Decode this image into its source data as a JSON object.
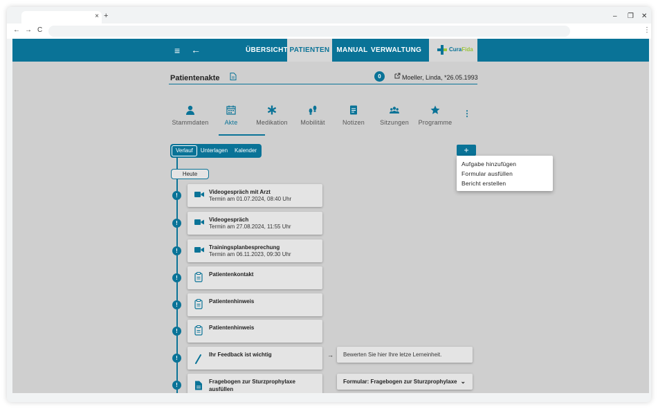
{
  "browser": {
    "tab_close": "×",
    "new_tab": "+",
    "minimize": "–",
    "restore": "❐",
    "close": "✕",
    "back": "←",
    "forward": "→",
    "reload": "C",
    "menu": "⋮"
  },
  "app": {
    "burger": "≡",
    "back": "←",
    "nav": [
      "ÜBERSICHT",
      "PATIENTEN",
      "MANUAL",
      "VERWALTUNG"
    ],
    "active_nav": "PATIENTEN",
    "logo_a": "Cura",
    "logo_b": "Fida",
    "brand_color": "#0a7397",
    "logo_accent": "#9bc43a"
  },
  "patient": {
    "title": "Patientenakte",
    "badge": "0",
    "name": "Moeller, Linda, *26.05.1993"
  },
  "tabs": [
    "Stammdaten",
    "Akte",
    "Medikation",
    "Mobilität",
    "Notizen",
    "Sitzungen",
    "Programme"
  ],
  "active_tab": "Akte",
  "more": "⋮",
  "segments": [
    "Verlauf",
    "Unterlagen",
    "Kalender"
  ],
  "active_segment": "Verlauf",
  "add_button": "+",
  "add_menu": [
    "Aufgabe hinzufügen",
    "Formular ausfüllen",
    "Bericht erstellen"
  ],
  "today_label": "Heute",
  "marker": "!",
  "arrow": "→",
  "chevron": "⌄",
  "timeline": [
    {
      "icon": "video-icon",
      "title": "Videogespräch mit Arzt",
      "subtitle": "Termin am 01.07.2024, 08:40 Uhr"
    },
    {
      "icon": "video-icon",
      "title": "Videogespräch",
      "subtitle": "Termin am 27.08.2024, 11:55 Uhr"
    },
    {
      "icon": "video-icon",
      "title": "Trainingsplanbesprechung",
      "subtitle": "Termin am 06.11.2023, 09:30 Uhr"
    },
    {
      "icon": "clipboard-icon",
      "title": "Patientenkontakt",
      "subtitle": ""
    },
    {
      "icon": "clipboard-icon",
      "title": "Patientenhinweis",
      "subtitle": ""
    },
    {
      "icon": "clipboard-icon",
      "title": "Patientenhinweis",
      "subtitle": ""
    },
    {
      "icon": "pen-icon",
      "title": "Ihr Feedback ist wichtig",
      "subtitle": ""
    },
    {
      "icon": "document-icon",
      "title": "Fragebogen zur Sturzprophylaxe ausfüllen",
      "subtitle": ""
    }
  ],
  "feedback_text": "Bewerten Sie hier Ihre letze Lerneinheit.",
  "form_text": "Formular: Fragebogen zur Sturzprophylaxe"
}
